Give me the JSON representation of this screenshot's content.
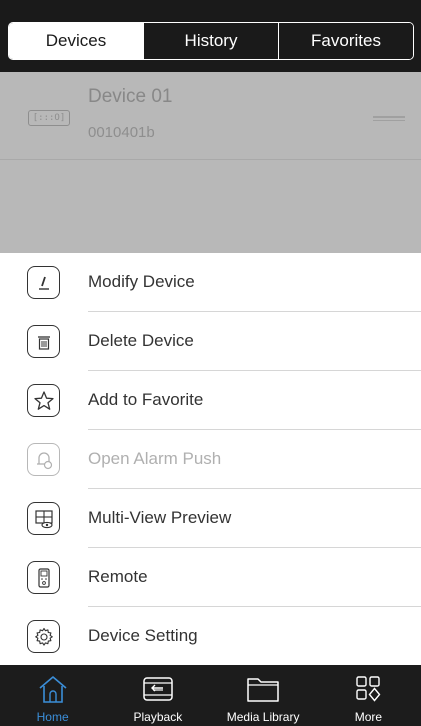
{
  "tabs": {
    "items": [
      {
        "label": "Devices",
        "active": true
      },
      {
        "label": "History",
        "active": false
      },
      {
        "label": "Favorites",
        "active": false
      }
    ]
  },
  "device": {
    "icon_text": "[:::O]",
    "name": "Device 01",
    "id": "0010401b"
  },
  "menu": {
    "items": [
      {
        "label": "Modify Device",
        "icon": "pencil-icon",
        "enabled": true
      },
      {
        "label": "Delete Device",
        "icon": "trash-icon",
        "enabled": true
      },
      {
        "label": "Add to Favorite",
        "icon": "star-icon",
        "enabled": true
      },
      {
        "label": "Open Alarm Push",
        "icon": "alarm-push-icon",
        "enabled": false
      },
      {
        "label": "Multi-View Preview",
        "icon": "multi-view-icon",
        "enabled": true
      },
      {
        "label": "Remote",
        "icon": "remote-icon",
        "enabled": true
      },
      {
        "label": "Device Setting",
        "icon": "gear-icon",
        "enabled": true
      }
    ]
  },
  "tabbar": {
    "items": [
      {
        "label": "Home",
        "icon": "home-icon",
        "active": true
      },
      {
        "label": "Playback",
        "icon": "playback-icon",
        "active": false
      },
      {
        "label": "Media Library",
        "icon": "folder-icon",
        "active": false
      },
      {
        "label": "More",
        "icon": "grid-more-icon",
        "active": false
      }
    ]
  },
  "colors": {
    "accent": "#3b8ed8",
    "dark": "#1a1a1a",
    "overlay": "#b8b8b8"
  }
}
